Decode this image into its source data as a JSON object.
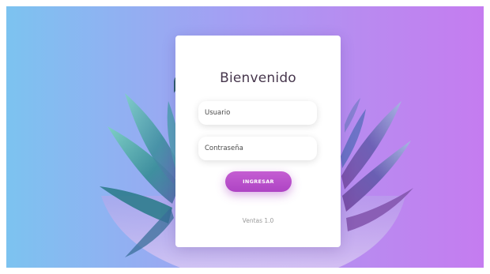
{
  "login": {
    "title": "Bienvenido",
    "username_placeholder": "Usuario",
    "password_placeholder": "Contraseña",
    "submit_label": "INGRESAR",
    "version": "Ventas 1.0"
  },
  "theme": {
    "gradient_left": "#7cc3f0",
    "gradient_right": "#c57cf0",
    "button_color": "#b94fcb",
    "plant_leaf_color": "#3f8fa0"
  },
  "background_image": "succulent-plant-illustration"
}
